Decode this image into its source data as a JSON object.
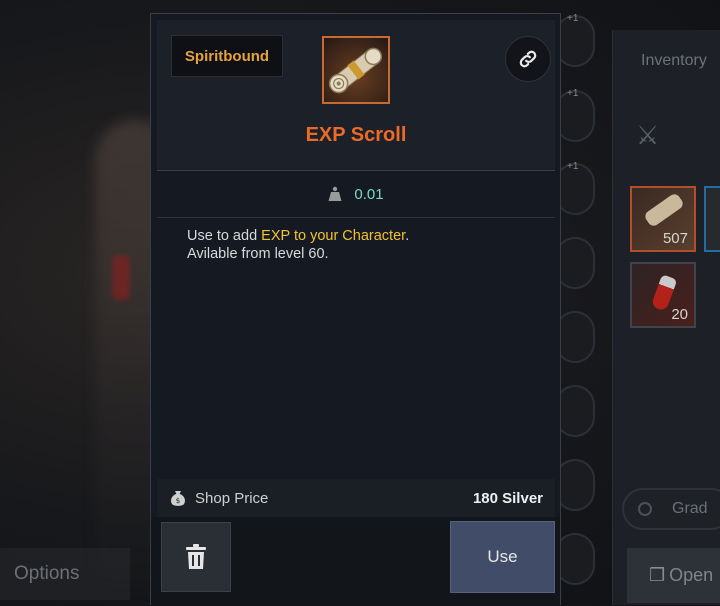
{
  "background": {
    "options_label": "Options",
    "inventory_title": "Inventory",
    "slot_counts": [
      "507",
      "20"
    ],
    "grade_label": "Grad",
    "open_label": "Open",
    "ring_tags": [
      "+1",
      "+1",
      "+1"
    ]
  },
  "tooltip": {
    "badge": "Spiritbound",
    "item_name": "EXP Scroll",
    "weight": "0.01",
    "description": {
      "line1_prefix": "Use to add ",
      "line1_highlight": "EXP to your Character",
      "line1_suffix": ".",
      "line2": "Avilable from level 60."
    },
    "shop_price_label": "Shop Price",
    "shop_price_value": "180 Silver",
    "use_label": "Use"
  },
  "colors": {
    "item_name": "#ec6a26",
    "badge_text": "#e6a23e",
    "weight_value": "#7fd6c8",
    "highlight": "#f1c232",
    "use_button": "#414c68"
  },
  "icons": {
    "link": "link-icon",
    "weight": "weight-icon",
    "money": "money-bag-icon",
    "trash": "trash-icon",
    "item": "scroll-icon"
  }
}
